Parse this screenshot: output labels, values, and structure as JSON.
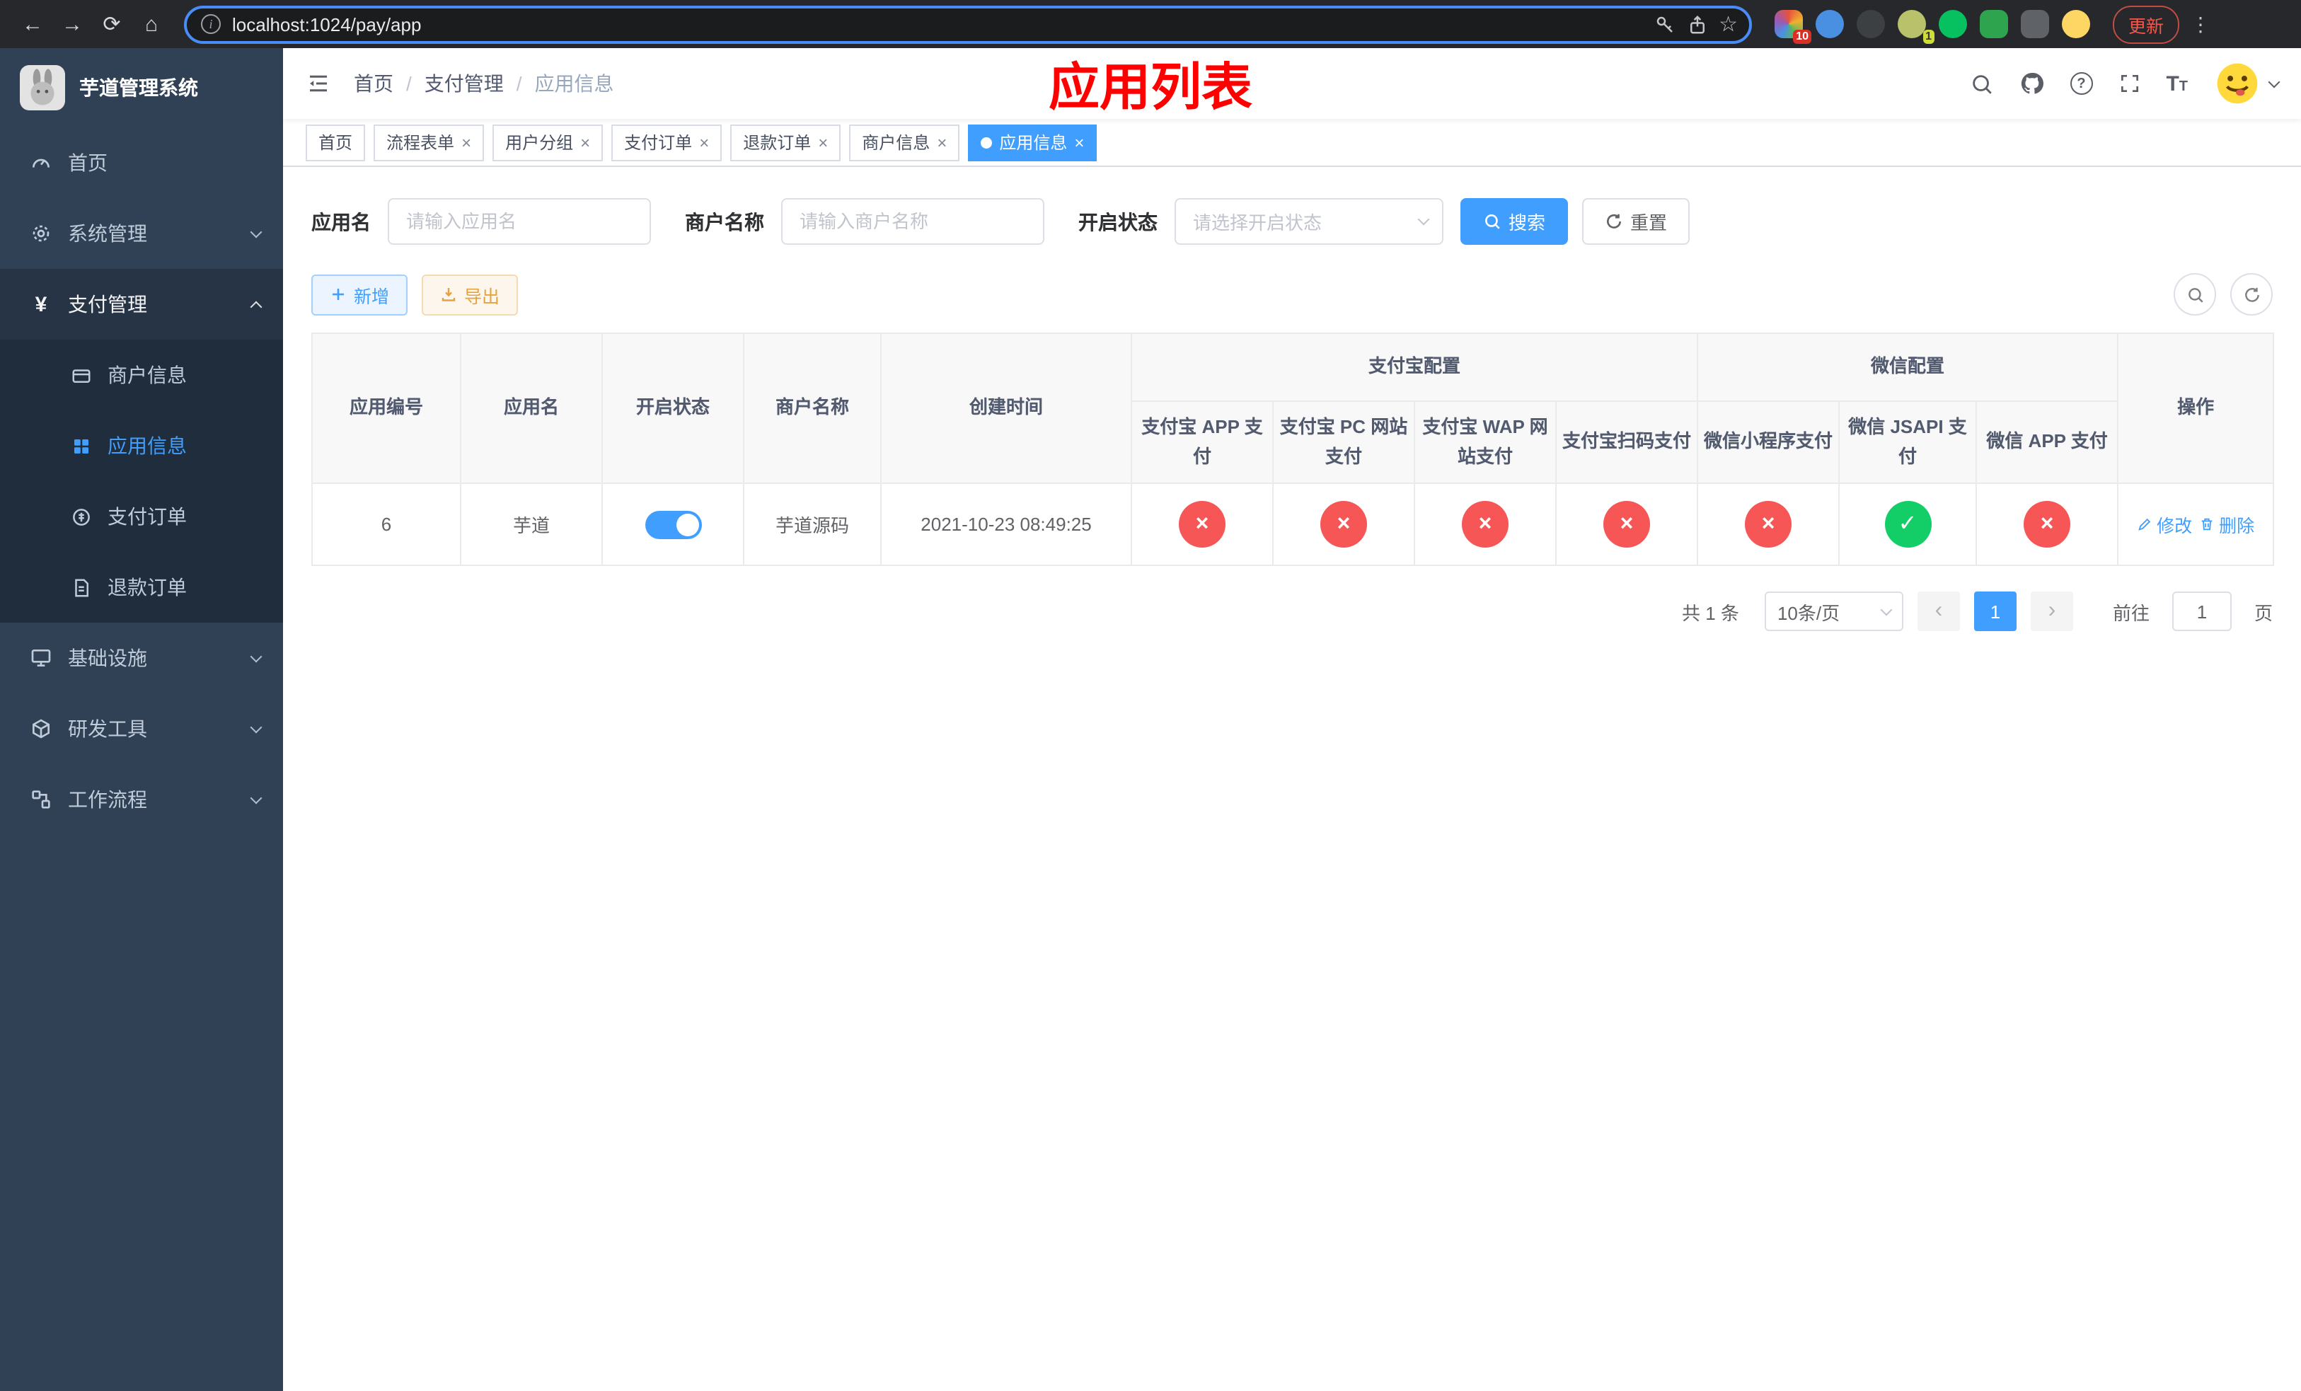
{
  "browser": {
    "url": "localhost:1024/pay/app",
    "update_button": "更新",
    "extension_badge": "10",
    "avatar_badge": "1"
  },
  "sidebar": {
    "app_title": "芋道管理系统",
    "items": [
      {
        "label": "首页"
      },
      {
        "label": "系统管理"
      },
      {
        "label": "支付管理"
      },
      {
        "label": "基础设施"
      },
      {
        "label": "研发工具"
      },
      {
        "label": "工作流程"
      }
    ],
    "payment_children": [
      {
        "label": "商户信息"
      },
      {
        "label": "应用信息"
      },
      {
        "label": "支付订单"
      },
      {
        "label": "退款订单"
      }
    ]
  },
  "breadcrumb": {
    "items": [
      "首页",
      "支付管理",
      "应用信息"
    ]
  },
  "page_title": "应用列表",
  "tabs": [
    {
      "label": "首页"
    },
    {
      "label": "流程表单"
    },
    {
      "label": "用户分组"
    },
    {
      "label": "支付订单"
    },
    {
      "label": "退款订单"
    },
    {
      "label": "商户信息"
    },
    {
      "label": "应用信息"
    }
  ],
  "filters": {
    "app_name_label": "应用名",
    "app_name_placeholder": "请输入应用名",
    "merchant_name_label": "商户名称",
    "merchant_name_placeholder": "请输入商户名称",
    "status_label": "开启状态",
    "status_placeholder": "请选择开启状态",
    "search_label": "搜索",
    "reset_label": "重置"
  },
  "toolbar": {
    "add": "新增",
    "export": "导出"
  },
  "table": {
    "header": {
      "app_id": "应用编号",
      "app_name": "应用名",
      "status": "开启状态",
      "merchant_name": "商户名称",
      "create_time": "创建时间",
      "alipay_group": "支付宝配置",
      "wechat_group": "微信配置",
      "alipay_app": "支付宝 APP 支付",
      "alipay_pc": "支付宝 PC 网站支付",
      "alipay_wap": "支付宝 WAP 网站支付",
      "alipay_qr": "支付宝扫码支付",
      "wx_lite": "微信小程序支付",
      "wx_jsapi": "微信 JSAPI 支付",
      "wx_app": "微信 APP 支付",
      "actions": "操作"
    },
    "rows": [
      {
        "app_id": "6",
        "app_name": "芋道",
        "enabled": true,
        "merchant_name": "芋道源码",
        "create_time": "2021-10-23 08:49:25",
        "channels": [
          false,
          false,
          false,
          false,
          false,
          true,
          false
        ],
        "edit": "修改",
        "delete": "删除"
      }
    ]
  },
  "pagination": {
    "total": "共 1 条",
    "page_size": "10条/页",
    "page": "1",
    "goto": "前往",
    "goto_value": "1",
    "unit": "页"
  }
}
